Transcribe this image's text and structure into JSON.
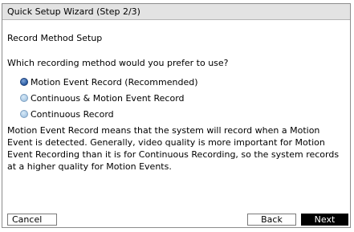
{
  "dialog": {
    "title": "Quick Setup Wizard (Step 2/3)",
    "section_title": "Record Method Setup",
    "question": "Which recording method would you prefer to use?",
    "options": [
      {
        "label": "Motion Event Record (Recommended)",
        "selected": true
      },
      {
        "label": "Continuous & Motion Event Record",
        "selected": false
      },
      {
        "label": "Continuous Record",
        "selected": false
      }
    ],
    "description": "Motion Event Record means that the system will record when a Motion Event is detected. Generally, video quality is more important for Motion Event Recording than it is for Continuous Recording, so the system records at a higher quality for Motion Events."
  },
  "buttons": {
    "cancel": "Cancel",
    "back": "Back",
    "next": "Next"
  },
  "colors": {
    "title_bar": "#e3e3e3",
    "radio_selected": "#2e5fa6",
    "radio_unselected": "#a9c8e4",
    "next_button_bg": "#000000"
  }
}
